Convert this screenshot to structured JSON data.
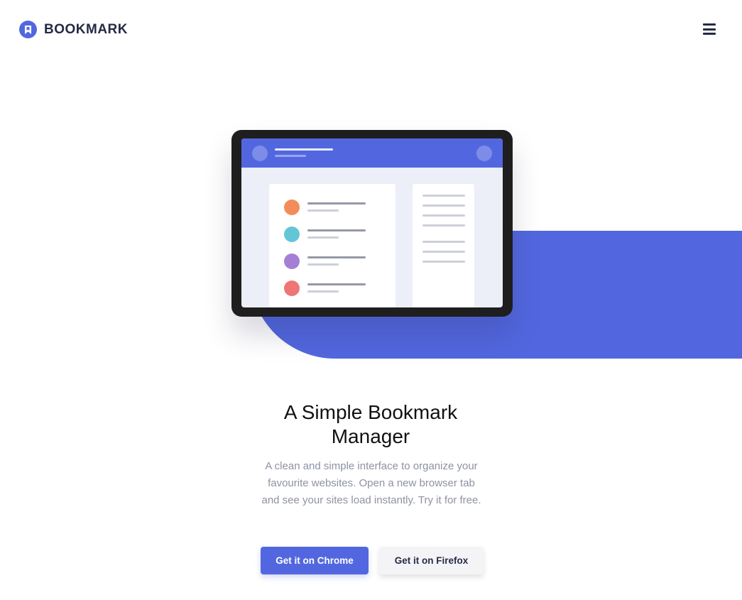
{
  "header": {
    "brand": "BOOKMARK",
    "logo_icon": "bookmark-icon",
    "menu_icon": "hamburger-menu-icon"
  },
  "hero": {
    "title": "A Simple Bookmark Manager",
    "description": "A clean and simple interface to organize your favourite websites. Open a new browser tab and see your sites load instantly. Try it for free.",
    "illustration": "tablet-bookmark-app-illustration"
  },
  "buttons": {
    "chrome_label": "Get it on Chrome",
    "firefox_label": "Get it on Firefox"
  },
  "colors": {
    "primary": "#5267df",
    "dark": "#242a45",
    "muted": "#8e92a3",
    "item_colors": [
      "#f28c5b",
      "#63c6d6",
      "#a57fd6",
      "#ee7676"
    ]
  }
}
